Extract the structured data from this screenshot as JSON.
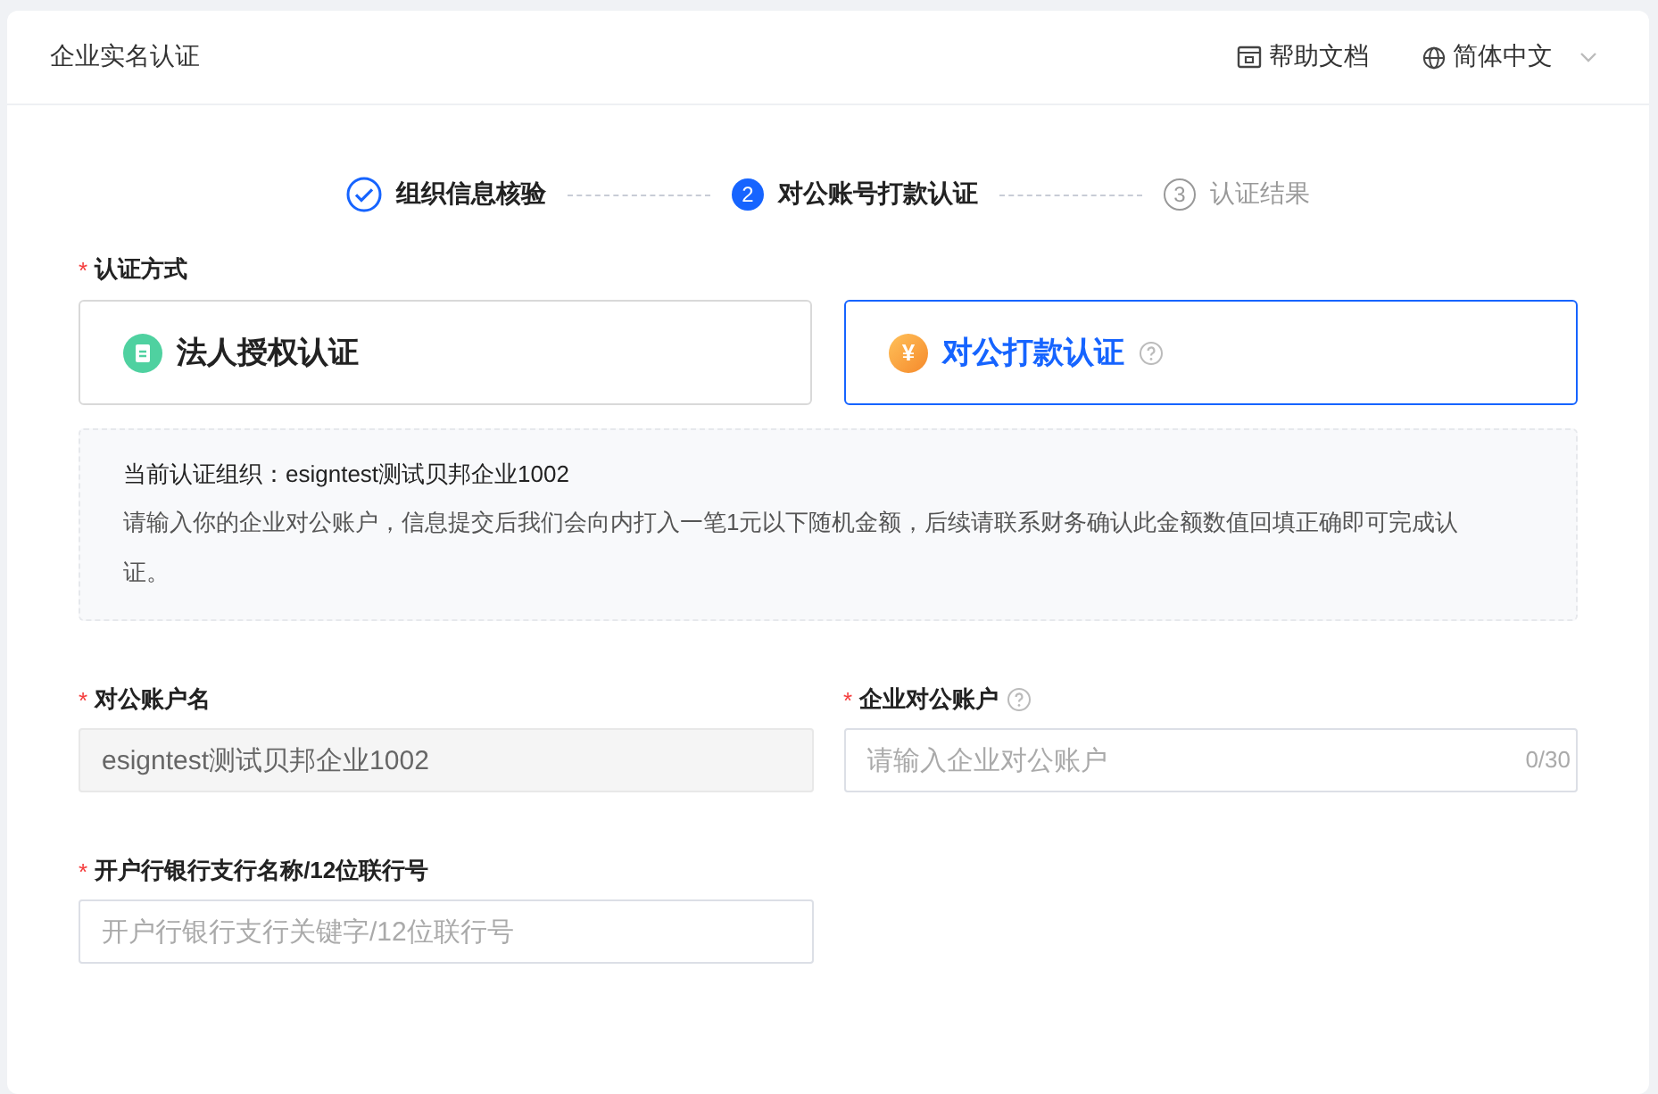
{
  "header": {
    "title": "企业实名认证",
    "help": "帮助文档",
    "language": "简体中文"
  },
  "steps": [
    {
      "label": "组织信息核验",
      "completed": true,
      "selected": false
    },
    {
      "number": "2",
      "label": "对公账号打款认证",
      "completed": false,
      "selected": true
    },
    {
      "number": "3",
      "label": "认证结果",
      "completed": false,
      "selected": false
    }
  ],
  "method": {
    "required_mark": "*",
    "label": "认证方式",
    "options": [
      {
        "kind": "document",
        "label": "法人授权认证",
        "selected": false,
        "help": false
      },
      {
        "kind": "currency",
        "icon_text": "¥",
        "label": "对公打款认证",
        "selected": true,
        "help": true
      }
    ]
  },
  "info": {
    "org": "当前认证组织：esigntest测试贝邦企业1002",
    "text": "请输入你的企业对公账户，信息提交后我们会向内打入一笔1元以下随机金额，后续请联系财务确认此金额数值回填正确即可完成认证。"
  },
  "fields": [
    {
      "required_mark": "*",
      "label": "对公账户名",
      "help": false,
      "disabled": true,
      "value": "esigntest测试贝邦企业1002"
    },
    {
      "required_mark": "*",
      "label": "企业对公账户",
      "help": true,
      "disabled": false,
      "placeholder": "请输入企业对公账户",
      "counter": "0/30"
    },
    {
      "required_mark": "*",
      "label": "开户行银行支行名称/12位联行号",
      "help": false,
      "disabled": false,
      "placeholder": "开户行银行支行关键字/12位联行号"
    }
  ]
}
